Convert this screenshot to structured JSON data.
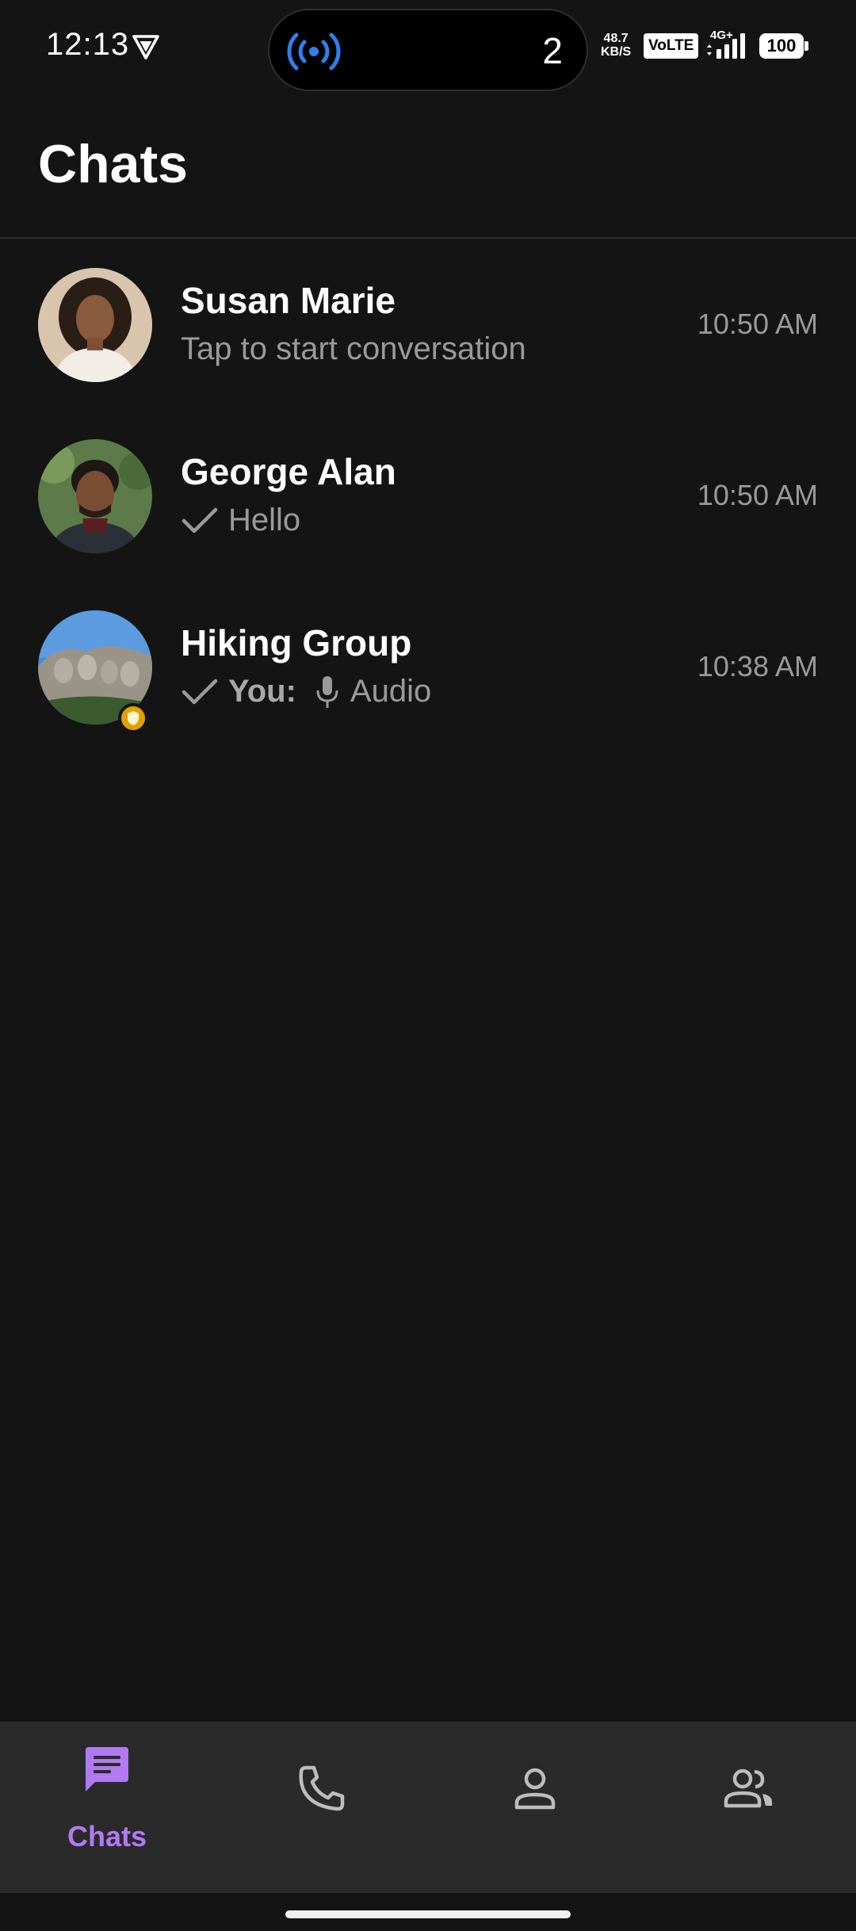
{
  "status_bar": {
    "time": "12:13",
    "island_count": "2",
    "net_speed_value": "48.7",
    "net_speed_unit": "KB/S",
    "volte": "VoLTE",
    "net_type": "4G+",
    "battery": "100",
    "icons": [
      "vpn-icon",
      "broadcast-icon",
      "signal-icon",
      "battery-icon"
    ]
  },
  "header": {
    "title": "Chats"
  },
  "chats": [
    {
      "name": "Susan Marie",
      "preview": "Tap to start conversation",
      "time": "10:50 AM"
    },
    {
      "name": "George Alan",
      "preview": "Hello",
      "time": "10:50 AM",
      "status_icon": "check-icon"
    },
    {
      "name": "Hiking Group",
      "sender": "You:",
      "preview": "Audio",
      "time": "10:38 AM",
      "status_icon": "check-icon",
      "attachment_icon": "mic-icon",
      "badge_icon": "shield-icon"
    }
  ],
  "bottom_nav": {
    "items": [
      {
        "label": "Chats",
        "icon": "chat-icon",
        "active": true
      },
      {
        "icon": "phone-icon"
      },
      {
        "icon": "person-icon"
      },
      {
        "icon": "people-icon"
      }
    ]
  },
  "colors": {
    "background": "#141414",
    "accent": "#b27af2",
    "nav_background": "#2a2a2a",
    "island_icon": "#2f80ed",
    "badge": "#e0a100"
  }
}
